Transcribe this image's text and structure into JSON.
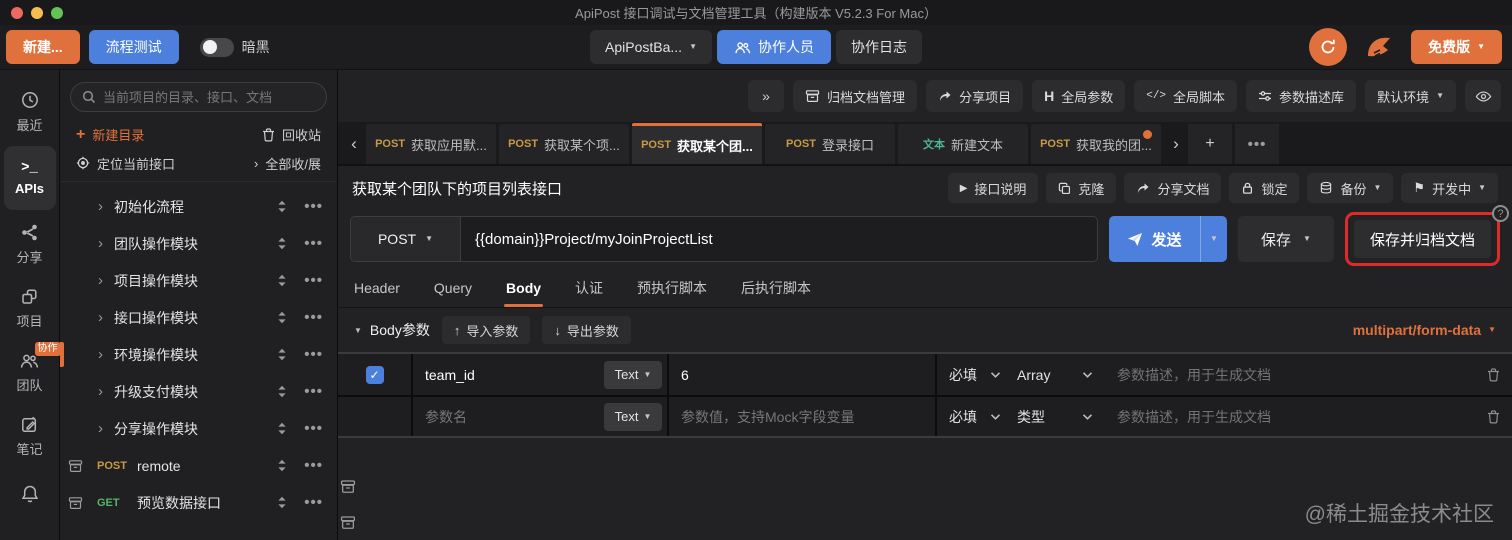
{
  "titlebar": {
    "title": "ApiPost 接口调试与文档管理工具（构建版本 V5.2.3 For Mac）"
  },
  "toolbar": {
    "new_label": "新建...",
    "flow_label": "流程测试",
    "dark_label": "暗黑",
    "workspace_label": "ApiPostBa...",
    "members_label": "协作人员",
    "log_label": "协作日志",
    "free_label": "免费版"
  },
  "rail": {
    "items": [
      {
        "label": "最近"
      },
      {
        "label": "APIs"
      },
      {
        "label": "分享"
      },
      {
        "label": "项目"
      },
      {
        "label": "团队",
        "badge": "协作"
      },
      {
        "label": "笔记"
      }
    ]
  },
  "sidebar": {
    "search_placeholder": "当前项目的目录、接口、文档",
    "new_dir_label": "新建目录",
    "recycle_label": "回收站",
    "locate_label": "定位当前接口",
    "toggle_all_label": "全部收/展",
    "folders": [
      "初始化流程",
      "团队操作模块",
      "项目操作模块",
      "接口操作模块",
      "环境操作模块",
      "升级支付模块",
      "分享操作模块"
    ],
    "apis": [
      {
        "method": "POST",
        "name": "remote"
      },
      {
        "method": "GET",
        "name": "预览数据接口"
      }
    ]
  },
  "header_actions": {
    "archive_mgmt": "归档文档管理",
    "share_project": "分享项目",
    "global_params": "全局参数",
    "global_script": "全局脚本",
    "param_desc_lib": "参数描述库",
    "env_selected": "默认环境"
  },
  "tabs": {
    "items": [
      {
        "method": "POST",
        "label": "获取应用默..."
      },
      {
        "method": "POST",
        "label": "获取某个项..."
      },
      {
        "method": "POST",
        "label": "获取某个团..."
      },
      {
        "method": "POST",
        "label": "登录接口"
      },
      {
        "method": "文本",
        "label": "新建文本"
      },
      {
        "method": "POST",
        "label": "获取我的团..."
      }
    ]
  },
  "request": {
    "title": "获取某个团队下的项目列表接口",
    "doc_label": "接口说明",
    "clone_label": "克隆",
    "share_label": "分享文档",
    "lock_label": "锁定",
    "backup_label": "备份",
    "status_label": "开发中",
    "method": "POST",
    "url": "{{domain}}Project/myJoinProjectList",
    "send_label": "发送",
    "save_label": "保存",
    "save_archive_label": "保存并归档文档"
  },
  "param_tabs": {
    "items": [
      "Header",
      "Query",
      "Body",
      "认证",
      "预执行脚本",
      "后执行脚本"
    ],
    "active": "Body"
  },
  "body_bar": {
    "section_label": "Body参数",
    "import_label": "导入参数",
    "export_label": "导出参数",
    "content_type": "multipart/form-data"
  },
  "table": {
    "rows": [
      {
        "name": "team_id",
        "type": "Text",
        "value": "6",
        "required": "必填",
        "data_type": "Array",
        "desc_placeholder": "参数描述，用于生成文档"
      },
      {
        "name_placeholder": "参数名",
        "type": "Text",
        "value_placeholder": "参数值，支持Mock字段变量",
        "required": "必填",
        "data_type": "类型",
        "desc_placeholder": "参数描述，用于生成文档"
      }
    ]
  },
  "watermark": "@稀土掘金技术社区",
  "icons": {
    "caret_down": "▼",
    "chevron_left": "‹",
    "chevron_right": "›",
    "double_chevron": "»",
    "plus": "+",
    "more_h": "•••",
    "check": "✓",
    "arrow_up": "↑",
    "arrow_down": "↓",
    "play": "▶",
    "flag": "⚑",
    "letter_h": "H",
    "code": "</>",
    "terminal": ">_",
    "question": "?"
  },
  "colors": {
    "accent": "#e0713c",
    "blue": "#4d80dc",
    "annotation_red": "#de2a2a",
    "method_post": "#c99a45",
    "method_get": "#58b368"
  }
}
